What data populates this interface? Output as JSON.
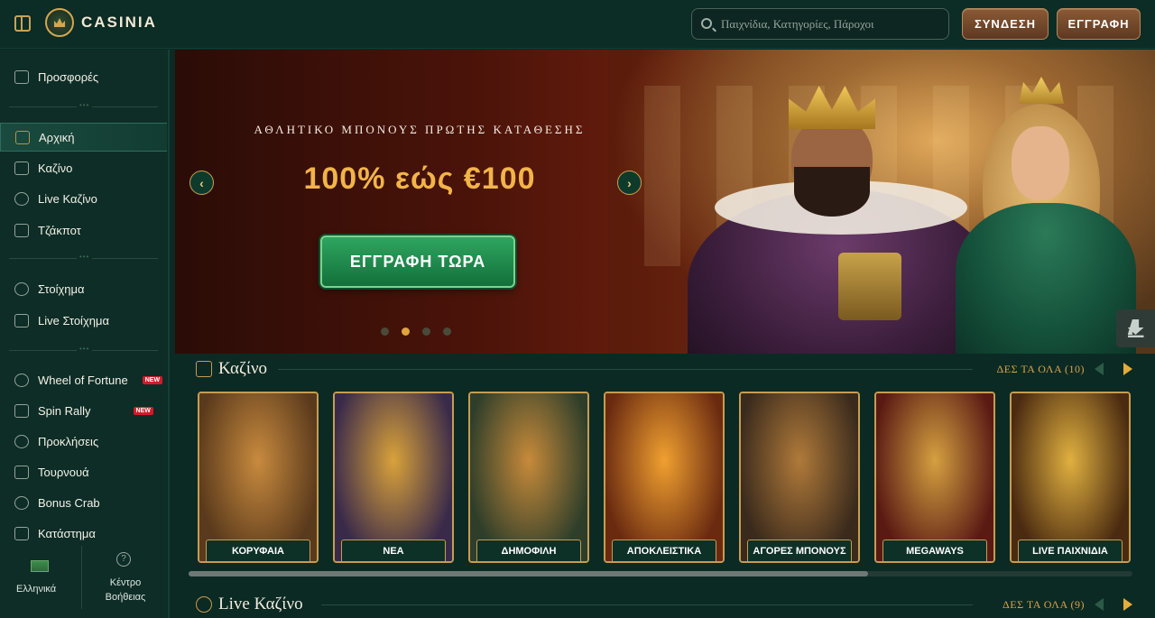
{
  "header": {
    "brand": "CASINIA",
    "search_placeholder": "Παιχνίδια, Κατηγορίες, Πάροχοι",
    "login_label": "ΣΥΝΔΕΣΗ",
    "register_label": "ΕΓΓΡΑΦΗ"
  },
  "sidebar": {
    "group1": [
      {
        "label": "Προσφορές",
        "icon": "gift-icon"
      }
    ],
    "group2": [
      {
        "label": "Αρχική",
        "icon": "home-icon",
        "active": true
      },
      {
        "label": "Καζίνο",
        "icon": "casino-icon"
      },
      {
        "label": "Live Καζίνο",
        "icon": "live-casino-icon"
      },
      {
        "label": "Τζάκποτ",
        "icon": "jackpot-icon"
      }
    ],
    "group3": [
      {
        "label": "Στοίχημα",
        "icon": "football-icon"
      },
      {
        "label": "Live Στοίχημα",
        "icon": "live-bet-icon"
      }
    ],
    "group4": [
      {
        "label": "Wheel of Fortune",
        "icon": "wheel-icon",
        "badge": "NEW"
      },
      {
        "label": "Spin Rally",
        "icon": "flag-icon",
        "badge": "NEW"
      },
      {
        "label": "Προκλήσεις",
        "icon": "challenge-icon"
      },
      {
        "label": "Τουρνουά",
        "icon": "trophy-icon"
      },
      {
        "label": "Bonus Crab",
        "icon": "crab-icon"
      },
      {
        "label": "Κατάστημα",
        "icon": "shop-icon"
      }
    ],
    "footer": {
      "language_label": "Ελληνικά",
      "help_label_1": "Κέντρο",
      "help_label_2": "Βοήθειας"
    }
  },
  "hero": {
    "subtitle": "ΑΘΛΗΤΙΚΟ ΜΠΟΝΟΥΣ ΠΡΩΤΗΣ ΚΑΤΑΘΕΣΗΣ",
    "title": "100% εώς €100",
    "cta_label": "ΕΓΓΡΑΦΗ ΤΩΡΑ",
    "prev_glyph": "‹",
    "next_glyph": "›",
    "slides_total": 4,
    "active_slide": 2
  },
  "casino_section": {
    "title": "Καζίνο",
    "see_all": "ΔΕΣ ΤΑ ΟΛΑ (10)",
    "cards": [
      {
        "label": "ΚΟΡΥΦΑΙΑ",
        "art": [
          "#5a3a1c",
          "#c88a3e"
        ]
      },
      {
        "label": "ΝΕΑ",
        "art": [
          "#3a2a4a",
          "#d9a23a"
        ]
      },
      {
        "label": "ΔΗΜΟΦΙΛΗ",
        "art": [
          "#2e3e2a",
          "#c78a3a"
        ]
      },
      {
        "label": "ΑΠΟΚΛΕΙΣΤΙΚΑ",
        "art": [
          "#6a2a10",
          "#f0a030"
        ]
      },
      {
        "label": "ΑΓΟΡΕΣ ΜΠΟΝΟΥΣ",
        "art": [
          "#3a2a1c",
          "#b07a3a"
        ]
      },
      {
        "label": "MEGAWAYS",
        "art": [
          "#5a1a14",
          "#d4a040"
        ]
      },
      {
        "label": "LIVE ΠΑΙΧΝΙΔΙΑ",
        "art": [
          "#4a2a10",
          "#e0b040"
        ]
      }
    ]
  },
  "live_section": {
    "title": "Live Καζίνο",
    "see_all": "ΔΕΣ ΤΑ ΟΛΑ (9)"
  },
  "scroll_progress": 0.72
}
